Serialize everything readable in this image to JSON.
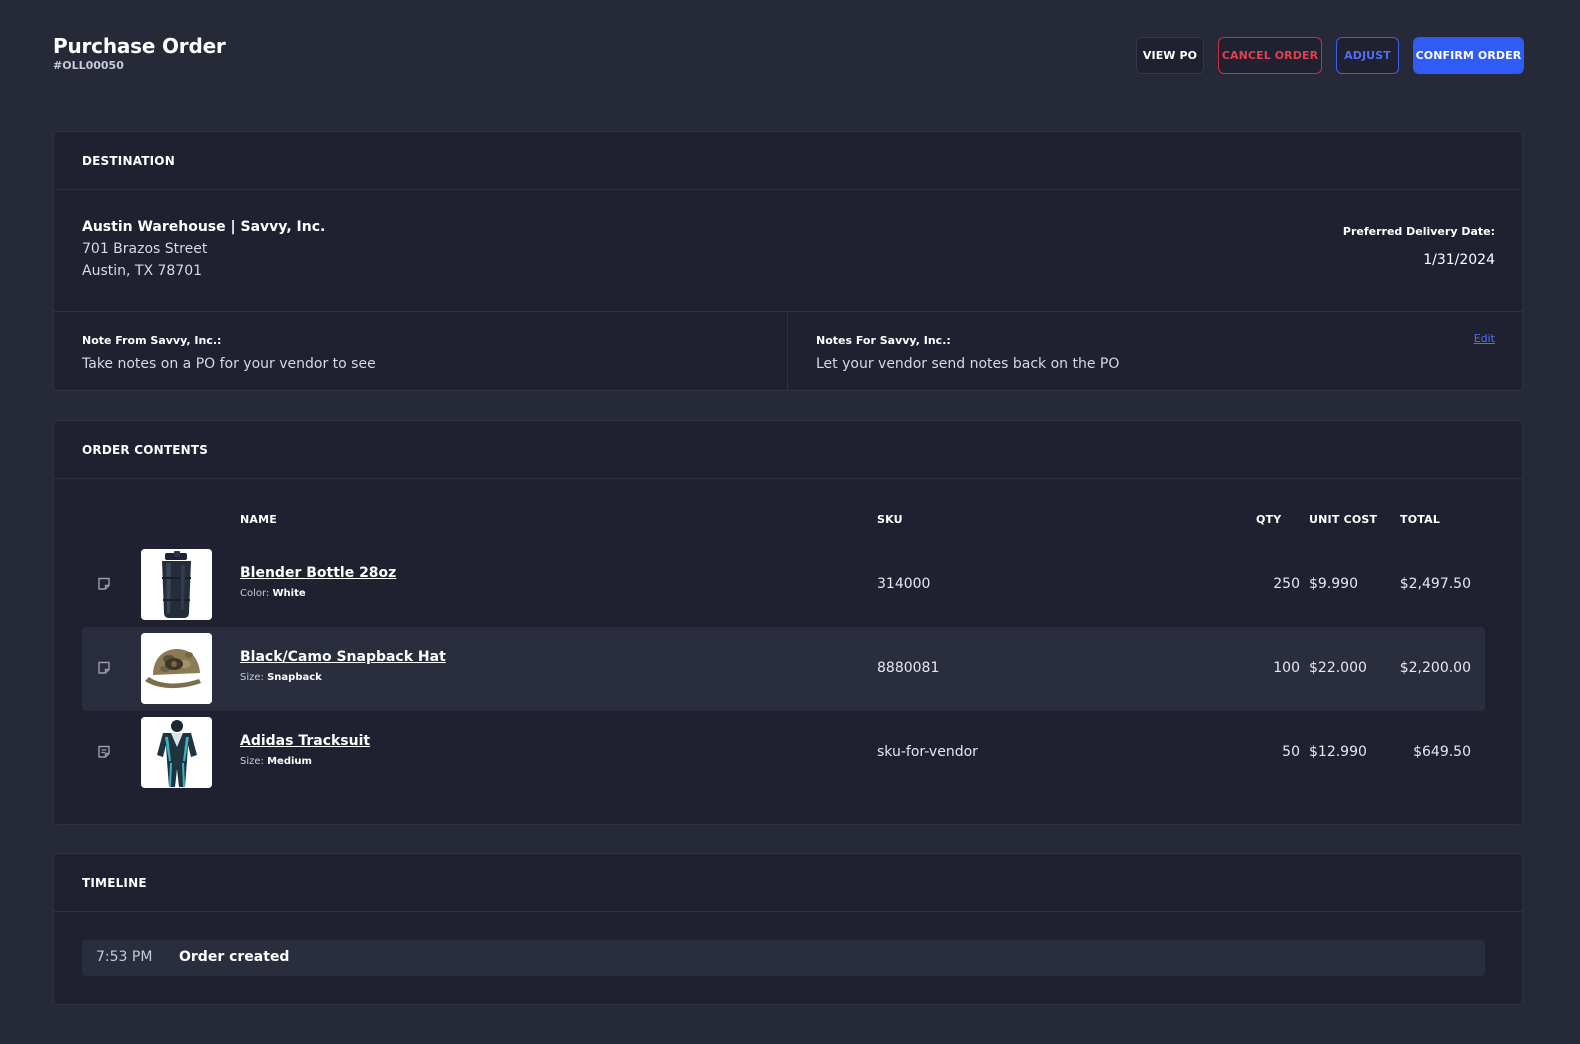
{
  "header": {
    "title": "Purchase Order",
    "po_number": "#OLL00050",
    "buttons": {
      "view_po": "VIEW PO",
      "cancel_order": "CANCEL ORDER",
      "adjust": "ADJUST",
      "confirm_order": "CONFIRM ORDER"
    }
  },
  "destination": {
    "section_title": "DESTINATION",
    "name": "Austin Warehouse | Savvy, Inc.",
    "address_line1": "701 Brazos Street",
    "address_line2": "Austin, TX 78701",
    "delivery_label": "Preferred Delivery Date:",
    "delivery_date": "1/31/2024",
    "note_from_label": "Note From Savvy, Inc.:",
    "note_from_text": "Take notes on a PO for your vendor to see",
    "notes_for_label": "Notes For Savvy, Inc.:",
    "notes_for_text": "Let your vendor send notes back on the PO",
    "edit_label": "Edit"
  },
  "order": {
    "section_title": "ORDER CONTENTS",
    "columns": {
      "name": "NAME",
      "sku": "SKU",
      "qty": "QTY",
      "unit_cost": "UNIT COST",
      "total": "TOTAL"
    },
    "items": [
      {
        "name": "Blender Bottle 28oz",
        "attr_label": "Color:",
        "attr_value": "White",
        "sku": "314000",
        "qty": "250",
        "unit_cost": "$9.990",
        "total": "$2,497.50",
        "thumb_icon": "shaker-bottle-image",
        "note_icon": "note-empty-icon"
      },
      {
        "name": "Black/Camo Snapback Hat",
        "attr_label": "Size:",
        "attr_value": "Snapback",
        "sku": "8880081",
        "qty": "100",
        "unit_cost": "$22.000",
        "total": "$2,200.00",
        "thumb_icon": "camo-hat-image",
        "note_icon": "note-empty-icon"
      },
      {
        "name": "Adidas Tracksuit",
        "attr_label": "Size:",
        "attr_value": "Medium",
        "sku": "sku-for-vendor",
        "qty": "50",
        "unit_cost": "$12.990",
        "total": "$649.50",
        "thumb_icon": "tracksuit-image",
        "note_icon": "note-filled-icon"
      }
    ]
  },
  "timeline": {
    "section_title": "TIMELINE",
    "events": [
      {
        "time": "7:53 PM",
        "event": "Order created"
      }
    ]
  },
  "colors": {
    "background": "#262938",
    "card": "#1f2130",
    "primary": "#2f5cf5",
    "danger": "#e0404f",
    "link": "#4f6ef5"
  }
}
